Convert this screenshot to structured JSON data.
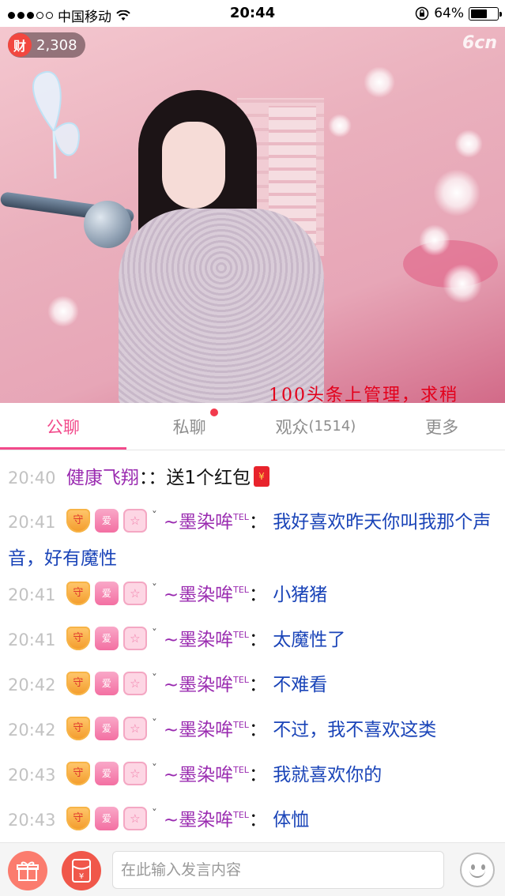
{
  "status_bar": {
    "carrier": "中国移动",
    "time": "20:44",
    "battery": "64%",
    "battery_level": 0.64,
    "icons": [
      "signal-dots-icon",
      "wifi-icon",
      "rotation-lock-icon",
      "battery-icon"
    ]
  },
  "video": {
    "wealth_icon_label": "财",
    "wealth_count": "2,308",
    "logo": "6cn",
    "overlay_text": "100头条上管理，求稍"
  },
  "tabs": [
    {
      "label": "公聊",
      "active": true
    },
    {
      "label": "私聊",
      "active": false,
      "has_dot": true
    },
    {
      "label": "观众",
      "count": "(1514)",
      "active": false
    },
    {
      "label": "更多",
      "active": false
    }
  ],
  "chat": {
    "messages": [
      {
        "time": "20:40",
        "user": "健康飞翔",
        "text": "送1个红包",
        "colon": "：",
        "sep": "：",
        "has_badges": false,
        "has_redpacket": true
      },
      {
        "time": "20:41",
        "user": "~墨染哞",
        "sup": "TEL",
        "text": "我好喜欢昨天你叫我那个声音，好有魔性",
        "colon": "：",
        "has_badges": true
      },
      {
        "time": "20:41",
        "user": "~墨染哞",
        "sup": "TEL",
        "text": "小猪猪",
        "colon": "：",
        "has_badges": true
      },
      {
        "time": "20:41",
        "user": "~墨染哞",
        "sup": "TEL",
        "text": "太魔性了",
        "colon": "：",
        "has_badges": true
      },
      {
        "time": "20:42",
        "user": "~墨染哞",
        "sup": "TEL",
        "text": "不难看",
        "colon": "：",
        "has_badges": true
      },
      {
        "time": "20:42",
        "user": "~墨染哞",
        "sup": "TEL",
        "text": "不过，我不喜欢这类",
        "colon": "：",
        "has_badges": true
      },
      {
        "time": "20:43",
        "user": "~墨染哞",
        "sup": "TEL",
        "text": "我就喜欢你的",
        "colon": "：",
        "has_badges": true
      },
      {
        "time": "20:43",
        "user": "~墨染哞",
        "sup": "TEL",
        "text": "体恤",
        "colon": "：",
        "has_badges": true
      }
    ],
    "badge_labels": {
      "guard": "守",
      "love": "爱",
      "star": "☆",
      "tick": "ˇ"
    },
    "redpacket_symbol": "¥"
  },
  "input_bar": {
    "placeholder": "在此输入发言内容",
    "icons": [
      "gift-icon",
      "red-packet-icon",
      "emoji-icon"
    ]
  },
  "colors": {
    "accent": "#f24a8b",
    "username": "#9a2bb0",
    "message": "#1a44b8",
    "timestamp": "#c2c2c2",
    "overlay_text": "#e3001b"
  }
}
